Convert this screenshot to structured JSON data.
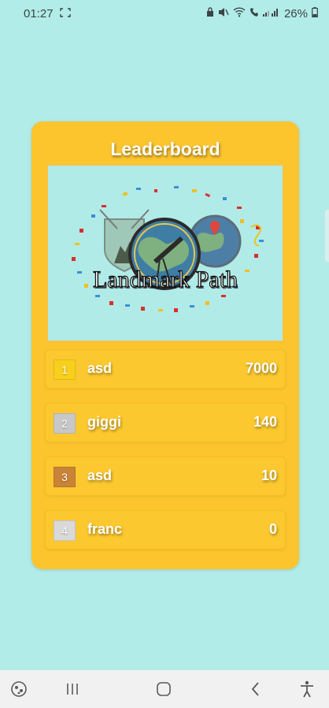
{
  "status_bar": {
    "time": "01:27",
    "battery": "26%"
  },
  "leaderboard": {
    "title": "Leaderboard",
    "banner_text": "Landmark Path",
    "entries": [
      {
        "rank": "1",
        "name": "asd",
        "score": "7000",
        "badge_color": "#f8d01c"
      },
      {
        "rank": "2",
        "name": "giggi",
        "score": "140",
        "badge_color": "#c8c8c8"
      },
      {
        "rank": "3",
        "name": "asd",
        "score": "10",
        "badge_color": "#c98337"
      },
      {
        "rank": "4",
        "name": "franc",
        "score": "0",
        "badge_color": "#d9d9d9"
      }
    ]
  },
  "colors": {
    "background": "#b2ece8",
    "card": "#fcc52e",
    "banner": "#b1ebe8"
  },
  "nav_icons": [
    "game-launcher-icon",
    "recent-apps-icon",
    "home-icon",
    "back-icon",
    "accessibility-icon"
  ]
}
